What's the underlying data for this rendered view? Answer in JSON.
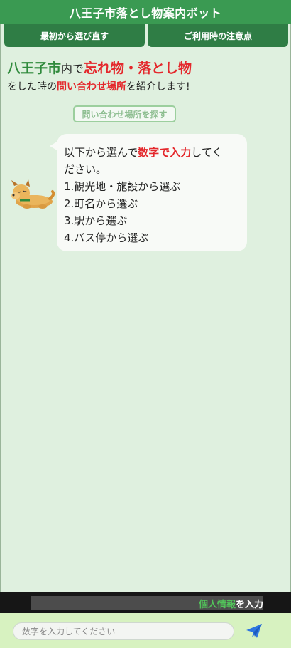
{
  "app": {
    "title": "八王子市落とし物案内ボット"
  },
  "nav": {
    "restart_label": "最初から選び直す",
    "notes_label": "ご利用時の注意点"
  },
  "heading": {
    "city": "八王子市",
    "mid1": "内で",
    "lost": "忘れ物・落とし物",
    "mid2": "をした時の",
    "contact": "問い合わせ場所",
    "end": "を紹介します!"
  },
  "search_button": {
    "label": "問い合わせ場所を探す"
  },
  "bot_message": {
    "pre": "以下から選んで",
    "emphasis": "数字で入力",
    "post": "してく",
    "line2": "ださい。",
    "options": [
      "1.観光地・施設から選ぶ",
      "2.町名から選ぶ",
      "3.駅から選ぶ",
      "4.バス停から選ぶ"
    ]
  },
  "ticker": {
    "highlight": "個人情報",
    "text": "を入力"
  },
  "composer": {
    "placeholder": "数字を入力してください",
    "send_icon": "paper-plane-icon"
  },
  "colors": {
    "title_bg": "#3a9a52",
    "nav_bg": "#2f7d45",
    "accent_red": "#e4282c",
    "page_bg": "#dff0df",
    "send_blue": "#2f76e0"
  }
}
